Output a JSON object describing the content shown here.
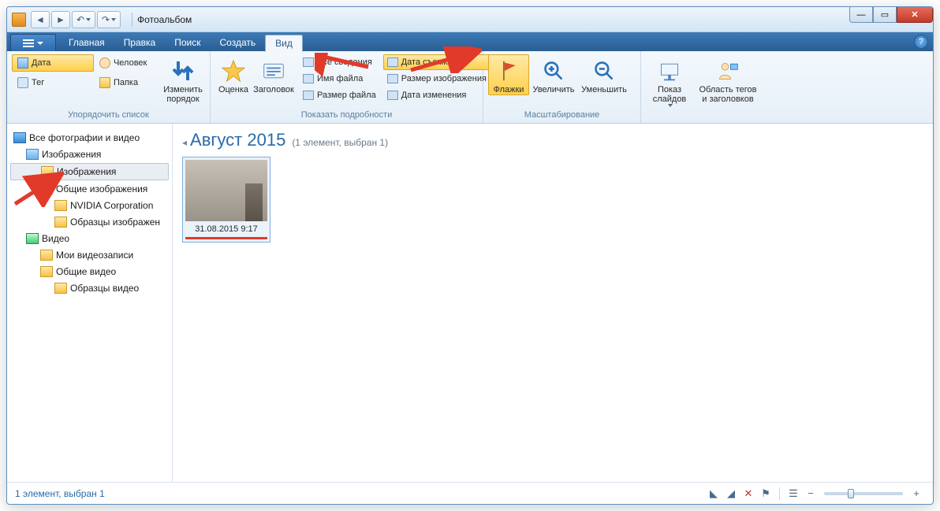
{
  "window": {
    "title": "Фотоальбом"
  },
  "tabs": {
    "home": "Главная",
    "edit": "Правка",
    "find": "Поиск",
    "create": "Создать",
    "view": "Вид"
  },
  "ribbon": {
    "arrange": {
      "date": "Дата",
      "tag": "Тег",
      "person": "Человек",
      "folder": "Папка",
      "reorder": "Изменить\nпорядок",
      "group_label": "Упорядочить список"
    },
    "rating": "Оценка",
    "caption": "Заголовок",
    "details": {
      "all": "Все сведения",
      "filename": "Имя файла",
      "filesize": "Размер файла",
      "date_taken": "Дата съемки",
      "image_size": "Размер изображения",
      "date_modified": "Дата изменения",
      "group_label": "Показать подробности"
    },
    "flags": "Флажки",
    "zoom_in": "Увеличить",
    "zoom_out": "Уменьшить",
    "zoom_group": "Масштабирование",
    "slideshow": "Показ\nслайдов",
    "tagpane": "Область тегов\nи заголовков"
  },
  "tree": {
    "all": "Все фотографии и видео",
    "images": "Изображения",
    "images_sub": "Изображения",
    "public_images": "Общие изображения",
    "nvidia": "NVIDIA Corporation",
    "samples_img": "Образцы изображен",
    "video": "Видео",
    "my_videos": "Мои видеозаписи",
    "public_videos": "Общие видео",
    "samples_vid": "Образцы видео"
  },
  "content": {
    "group_name": "Август 2015",
    "group_count": "(1 элемент, выбран 1)",
    "thumb_caption": "31.08.2015 9:17"
  },
  "status": {
    "text": "1 элемент, выбран 1"
  }
}
